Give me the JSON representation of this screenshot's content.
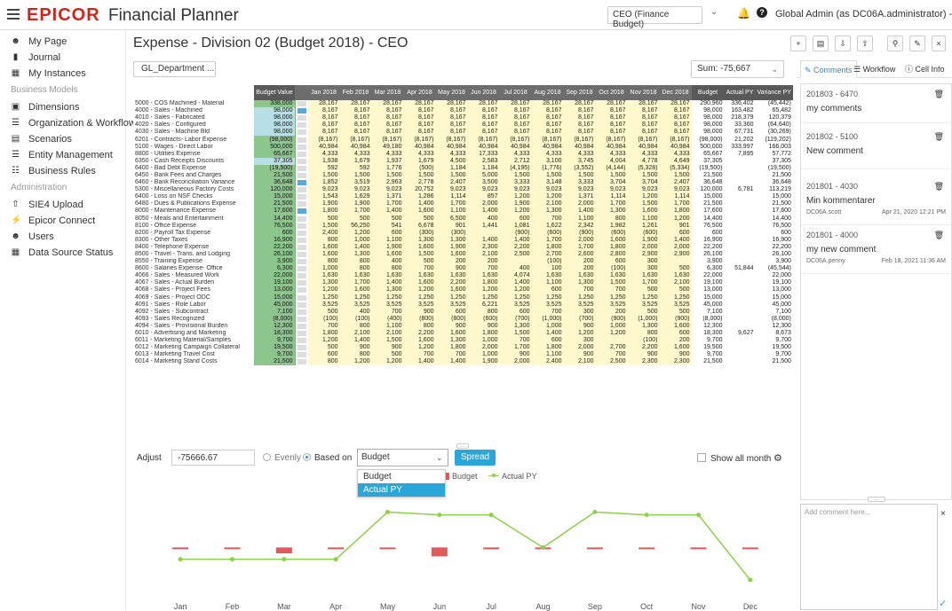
{
  "header": {
    "logo": "EPICOR",
    "product": "Financial Planner",
    "role": "CEO (Finance Budget)",
    "user": "Global Admin (as DC06A.administrator) - DC06A"
  },
  "sidebar": {
    "items": [
      {
        "label": "My Page",
        "icon": "people-icon"
      },
      {
        "label": "Journal",
        "icon": "document-icon"
      },
      {
        "label": "My Instances",
        "icon": "building-icon"
      }
    ],
    "section1": "Business Models",
    "models": [
      {
        "label": "Dimensions",
        "icon": "cube-icon"
      },
      {
        "label": "Organization & Workflow",
        "icon": "org-icon"
      },
      {
        "label": "Scenarios",
        "icon": "page-icon"
      },
      {
        "label": "Entity Management",
        "icon": "entity-icon"
      },
      {
        "label": "Business Rules",
        "icon": "rules-icon"
      }
    ],
    "section2": "Administration",
    "admin": [
      {
        "label": "SIE4 Upload",
        "icon": "upload-icon"
      },
      {
        "label": "Epicor Connect",
        "icon": "plug-icon"
      },
      {
        "label": "Users",
        "icon": "users-icon"
      },
      {
        "label": "Data Source Status",
        "icon": "grid-icon"
      }
    ]
  },
  "main": {
    "title": "Expense - Division 02 (Budget 2018) - CEO",
    "dimension_button": "GL_Department   ...",
    "sum": "Sum: -75,667"
  },
  "grid": {
    "columns": [
      "",
      "Budget Value",
      "",
      "Jan 2018",
      "Feb 2018",
      "Mar 2018",
      "Apr 2018",
      "May 2018",
      "Jun 2018",
      "Jul 2018",
      "Aug 2018",
      "Sep 2018",
      "Oct 2018",
      "Nov 2018",
      "Dec 2018",
      "Budget",
      "Actual PY",
      "Variance PY"
    ],
    "rows": [
      [
        "5000 - COS Machined - Material",
        "338,000",
        "",
        "28,167",
        "28,167",
        "28,167",
        "28,167",
        "28,167",
        "28,167",
        "28,167",
        "28,167",
        "28,167",
        "28,167",
        "28,167",
        "28,167",
        "290,960",
        "336,402",
        "(45,442)"
      ],
      [
        "4000 - Sales - Machined",
        "98,000",
        "b",
        "8,167",
        "8,167",
        "8,167",
        "8,167",
        "8,167",
        "8,167",
        "8,167",
        "8,167",
        "8,167",
        "8,167",
        "8,167",
        "8,167",
        "98,000",
        "163,482",
        "65,482"
      ],
      [
        "4010 - Sales - Fabricated",
        "98,000",
        "",
        "8,167",
        "8,167",
        "8,167",
        "8,167",
        "8,167",
        "8,167",
        "8,167",
        "8,167",
        "8,167",
        "8,167",
        "8,167",
        "8,167",
        "98,000",
        "218,379",
        "120,379"
      ],
      [
        "4020 - Sales - Configured",
        "98,000",
        "",
        "8,167",
        "8,167",
        "8,167",
        "8,167",
        "8,167",
        "8,167",
        "8,167",
        "8,167",
        "8,167",
        "8,167",
        "8,167",
        "8,167",
        "98,000",
        "33,360",
        "(64,640)"
      ],
      [
        "4030 - Sales - Machine Bld",
        "98,000",
        "",
        "8,167",
        "8,167",
        "8,167",
        "8,167",
        "8,167",
        "8,167",
        "8,167",
        "8,167",
        "8,167",
        "8,167",
        "8,167",
        "8,167",
        "98,000",
        "67,731",
        "(30,269)"
      ],
      [
        "6201 - Contracts- Labor Expense",
        "(98,000)",
        "",
        "(8,167)",
        "(8,167)",
        "(8,167)",
        "(8,167)",
        "(8,167)",
        "(8,167)",
        "(8,167)",
        "(8,167)",
        "(8,167)",
        "(8,167)",
        "(8,167)",
        "(8,167)",
        "(98,000)",
        "21,202",
        "(119,202)"
      ],
      [
        "5100 - Wages - Direct Labor",
        "500,000",
        "",
        "40,984",
        "40,984",
        "49,180",
        "40,984",
        "40,984",
        "40,984",
        "40,984",
        "40,984",
        "40,984",
        "40,984",
        "40,984",
        "40,984",
        "500,000",
        "333,997",
        "166,003"
      ],
      [
        "8800 - Utilities Expense",
        "65,667",
        "",
        "4,333",
        "4,333",
        "4,333",
        "4,333",
        "4,333",
        "17,333",
        "4,333",
        "4,333",
        "4,333",
        "4,333",
        "4,333",
        "4,333",
        "65,667",
        "7,895",
        "57,772"
      ],
      [
        "6350 - Cash Receipts Discounts",
        "37,305",
        "",
        "1,938",
        "1,679",
        "1,937",
        "1,679",
        "4,500",
        "2,583",
        "2,712",
        "3,100",
        "3,745",
        "4,004",
        "4,778",
        "4,649",
        "37,305",
        "",
        "37,305"
      ],
      [
        "6400 - Bad Debt Expense",
        "(19,500)",
        "",
        "592",
        "592",
        "1,776",
        "(500)",
        "1,184",
        "1,184",
        "(4,195)",
        "(1,776)",
        "(3,552)",
        "(4,144)",
        "(5,328)",
        "(5,334)",
        "(19,500)",
        "",
        "(19,500)"
      ],
      [
        "6450 - Bank Fees and Charges",
        "21,500",
        "",
        "1,500",
        "1,500",
        "1,500",
        "1,500",
        "1,500",
        "5,000",
        "1,500",
        "1,500",
        "1,500",
        "1,500",
        "1,500",
        "1,500",
        "21,500",
        "",
        "21,500"
      ],
      [
        "6460 - Bank Reconciliation Variance",
        "36,648",
        "b",
        "1,852",
        "3,519",
        "2,963",
        "2,778",
        "2,407",
        "3,500",
        "3,333",
        "3,148",
        "3,333",
        "3,704",
        "3,704",
        "2,407",
        "36,648",
        "",
        "36,648"
      ],
      [
        "5300 - Miscellaneous Factory Costs",
        "120,000",
        "",
        "9,023",
        "9,023",
        "9,023",
        "20,752",
        "9,023",
        "9,023",
        "9,023",
        "9,023",
        "9,023",
        "9,023",
        "9,023",
        "9,023",
        "120,000",
        "6,781",
        "113,219"
      ],
      [
        "6400 - Loss on NSF Checks",
        "15,000",
        "",
        "1,543",
        "1,629",
        "1,371",
        "1,286",
        "1,114",
        "857",
        "1,200",
        "1,200",
        "1,371",
        "1,114",
        "1,200",
        "1,114",
        "15,000",
        "",
        "15,000"
      ],
      [
        "6480 - Dues & Publications Expense",
        "21,500",
        "",
        "1,900",
        "1,900",
        "1,700",
        "1,400",
        "1,700",
        "2,000",
        "1,900",
        "2,100",
        "2,000",
        "1,700",
        "1,500",
        "1,700",
        "21,500",
        "",
        "21,500"
      ],
      [
        "8000 - Maintenance Expense",
        "17,600",
        "b",
        "1,800",
        "1,700",
        "1,400",
        "1,600",
        "1,100",
        "1,400",
        "1,200",
        "1,300",
        "1,400",
        "1,300",
        "1,600",
        "1,800",
        "17,600",
        "",
        "17,600"
      ],
      [
        "8050 - Meals and Entertainment",
        "14,400",
        "",
        "500",
        "500",
        "500",
        "500",
        "6,500",
        "400",
        "600",
        "700",
        "1,100",
        "800",
        "1,100",
        "1,200",
        "14,400",
        "",
        "14,400"
      ],
      [
        "8100 - Office Expense",
        "76,500",
        "",
        "1,500",
        "56,250",
        "541",
        "6,678",
        "901",
        "1,441",
        "1,081",
        "1,622",
        "2,342",
        "1,982",
        "1,261",
        "901",
        "76,500",
        "",
        "76,500"
      ],
      [
        "8200 - Payroll Tax Expense",
        "600",
        "",
        "2,400",
        "1,200",
        "600",
        "(300)",
        "(300)",
        "",
        "(900)",
        "(600)",
        "(900)",
        "(600)",
        "(600)",
        "600",
        "600",
        "",
        "600"
      ],
      [
        "8300 - Other Taxes",
        "16,900",
        "",
        "800",
        "1,000",
        "1,100",
        "1,300",
        "1,300",
        "1,400",
        "1,400",
        "1,700",
        "2,000",
        "1,600",
        "1,900",
        "1,400",
        "16,900",
        "",
        "16,900"
      ],
      [
        "8400 - Telephone Expense",
        "22,200",
        "",
        "1,600",
        "1,400",
        "1,900",
        "1,600",
        "1,900",
        "2,300",
        "2,200",
        "1,800",
        "1,700",
        "1,800",
        "2,000",
        "2,000",
        "22,200",
        "",
        "22,200"
      ],
      [
        "8500 - Travel - Trans. and Lodging",
        "26,100",
        "",
        "1,600",
        "1,300",
        "1,600",
        "1,500",
        "1,600",
        "2,100",
        "2,500",
        "2,700",
        "2,600",
        "2,800",
        "2,900",
        "2,900",
        "26,100",
        "",
        "26,100"
      ],
      [
        "8550 - Training Expense",
        "3,900",
        "",
        "800",
        "800",
        "400",
        "500",
        "200",
        "200",
        "",
        "(100)",
        "200",
        "600",
        "300",
        "",
        "3,900",
        "",
        "3,900"
      ],
      [
        "8600 - Salaries Expense- Office",
        "6,300",
        "",
        "1,000",
        "800",
        "800",
        "700",
        "900",
        "700",
        "400",
        "100",
        "200",
        "(100)",
        "300",
        "500",
        "6,300",
        "51,844",
        "(45,544)"
      ],
      [
        "4066 - Sales - Measured Work",
        "22,000",
        "",
        "1,630",
        "1,630",
        "1,630",
        "1,630",
        "1,630",
        "1,630",
        "4,074",
        "1,630",
        "1,630",
        "1,630",
        "1,630",
        "1,630",
        "22,000",
        "",
        "22,000"
      ],
      [
        "4067 - Sales - Actual Burden",
        "19,100",
        "",
        "1,300",
        "1,700",
        "1,400",
        "1,600",
        "2,200",
        "1,800",
        "1,400",
        "1,100",
        "1,300",
        "1,500",
        "1,700",
        "2,100",
        "19,100",
        "",
        "19,100"
      ],
      [
        "4068 - Sales - Project Fees",
        "13,000",
        "",
        "1,200",
        "1,600",
        "1,300",
        "1,200",
        "1,600",
        "1,200",
        "1,200",
        "600",
        "700",
        "700",
        "500",
        "500",
        "13,000",
        "",
        "13,000"
      ],
      [
        "4069 - Sales - Project ODC",
        "15,000",
        "",
        "1,250",
        "1,250",
        "1,250",
        "1,250",
        "1,250",
        "1,250",
        "1,250",
        "1,250",
        "1,250",
        "1,250",
        "1,250",
        "1,250",
        "15,000",
        "",
        "15,000"
      ],
      [
        "4091 - Sales - Role Labor",
        "45,000",
        "",
        "3,525",
        "3,525",
        "3,525",
        "3,525",
        "3,525",
        "6,221",
        "3,525",
        "3,525",
        "3,525",
        "3,525",
        "3,525",
        "3,525",
        "45,000",
        "",
        "45,000"
      ],
      [
        "4092 - Sales - Subcontract",
        "7,100",
        "",
        "500",
        "400",
        "700",
        "900",
        "600",
        "800",
        "600",
        "700",
        "300",
        "200",
        "500",
        "500",
        "7,100",
        "",
        "7,100"
      ],
      [
        "4093 - Sales Recognized",
        "(8,000)",
        "",
        "(100)",
        "(100)",
        "(400)",
        "(800)",
        "(800)",
        "(600)",
        "(700)",
        "(1,000)",
        "(700)",
        "(900)",
        "(1,000)",
        "(900)",
        "(8,000)",
        "",
        "(8,000)"
      ],
      [
        "4094 - Sales - Provisional Burden",
        "12,300",
        "",
        "700",
        "800",
        "1,100",
        "800",
        "900",
        "900",
        "1,300",
        "1,000",
        "900",
        "1,000",
        "1,300",
        "1,600",
        "12,300",
        "",
        "12,300"
      ],
      [
        "6010 - Advertising and Marketing",
        "18,300",
        "",
        "1,800",
        "2,100",
        "2,100",
        "2,200",
        "1,600",
        "1,800",
        "1,500",
        "1,400",
        "1,200",
        "1,200",
        "800",
        "600",
        "18,300",
        "9,627",
        "8,673"
      ],
      [
        "6011 - Marketing Material/Samples",
        "9,700",
        "",
        "1,200",
        "1,400",
        "1,500",
        "1,600",
        "1,300",
        "1,000",
        "700",
        "600",
        "300",
        "",
        "(100)",
        "200",
        "9,700",
        "",
        "9,700"
      ],
      [
        "6012 - Marketing Campaign Collateral",
        "19,500",
        "",
        "500",
        "900",
        "900",
        "1,200",
        "1,800",
        "2,000",
        "1,700",
        "1,800",
        "2,000",
        "2,700",
        "2,200",
        "1,600",
        "19,500",
        "",
        "19,500"
      ],
      [
        "6013 - Marketing Travel Cost",
        "9,700",
        "",
        "600",
        "800",
        "500",
        "700",
        "700",
        "1,000",
        "900",
        "1,100",
        "900",
        "700",
        "900",
        "900",
        "9,700",
        "",
        "9,700"
      ],
      [
        "6014 - Marketing Stand Costs",
        "21,500",
        "",
        "800",
        "1,200",
        "1,200",
        "1,400",
        "1,400",
        "1,900",
        "2,000",
        "2,400",
        "2,100",
        "2,500",
        "2,300",
        "2,300",
        "21,500",
        "",
        "21,500"
      ]
    ]
  },
  "adjust": {
    "label": "Adjust",
    "value": "-75666.67",
    "evenly": "Evenly",
    "based_on": "Based on",
    "method": "Budget",
    "spread": "Spread",
    "show_all": "Show all month"
  },
  "dropdown": {
    "options": [
      "Budget",
      "Actual PY"
    ]
  },
  "chart_data": {
    "type": "bar",
    "categories": [
      "Jan",
      "Feb",
      "Mar",
      "Apr",
      "May",
      "Jun",
      "Jul",
      "Aug",
      "Sep",
      "Oct",
      "Nov",
      "Dec"
    ],
    "series": [
      {
        "name": "Budget",
        "type": "bar",
        "values": [
          0,
          0,
          -2,
          0,
          0,
          -3,
          0,
          0,
          0,
          0,
          0,
          0
        ],
        "color": "#e05a5a"
      },
      {
        "name": "Actual PY",
        "type": "line",
        "values": [
          -4,
          -4,
          -4,
          -4,
          12,
          11,
          11,
          0,
          12,
          11,
          11,
          -11
        ],
        "color": "#8cd14a"
      }
    ],
    "ylim": [
      -14,
      16
    ],
    "legend_position": "top"
  },
  "panel": {
    "toolbar": [
      "+",
      "chart",
      "export",
      "import",
      "search",
      "edit",
      "close"
    ],
    "tabs": [
      "Comments",
      "Workflow",
      "Cell Info"
    ],
    "comments": [
      {
        "id": "201803 - 6470",
        "text": "my comments",
        "author": "",
        "date": ""
      },
      {
        "id": "201802 - 5100",
        "text": "New comment",
        "author": "",
        "date": ""
      },
      {
        "id": "201801 - 4030",
        "text": "Min kommentarer",
        "author": "DC06A.scott",
        "date": "Apr 21, 2020 12:21 PM"
      },
      {
        "id": "201801 - 4000",
        "text": "my new comment",
        "author": "DC06A.penny",
        "date": "Feb 18, 2021 11:36 AM"
      }
    ],
    "add_placeholder": "Add comment here..."
  }
}
